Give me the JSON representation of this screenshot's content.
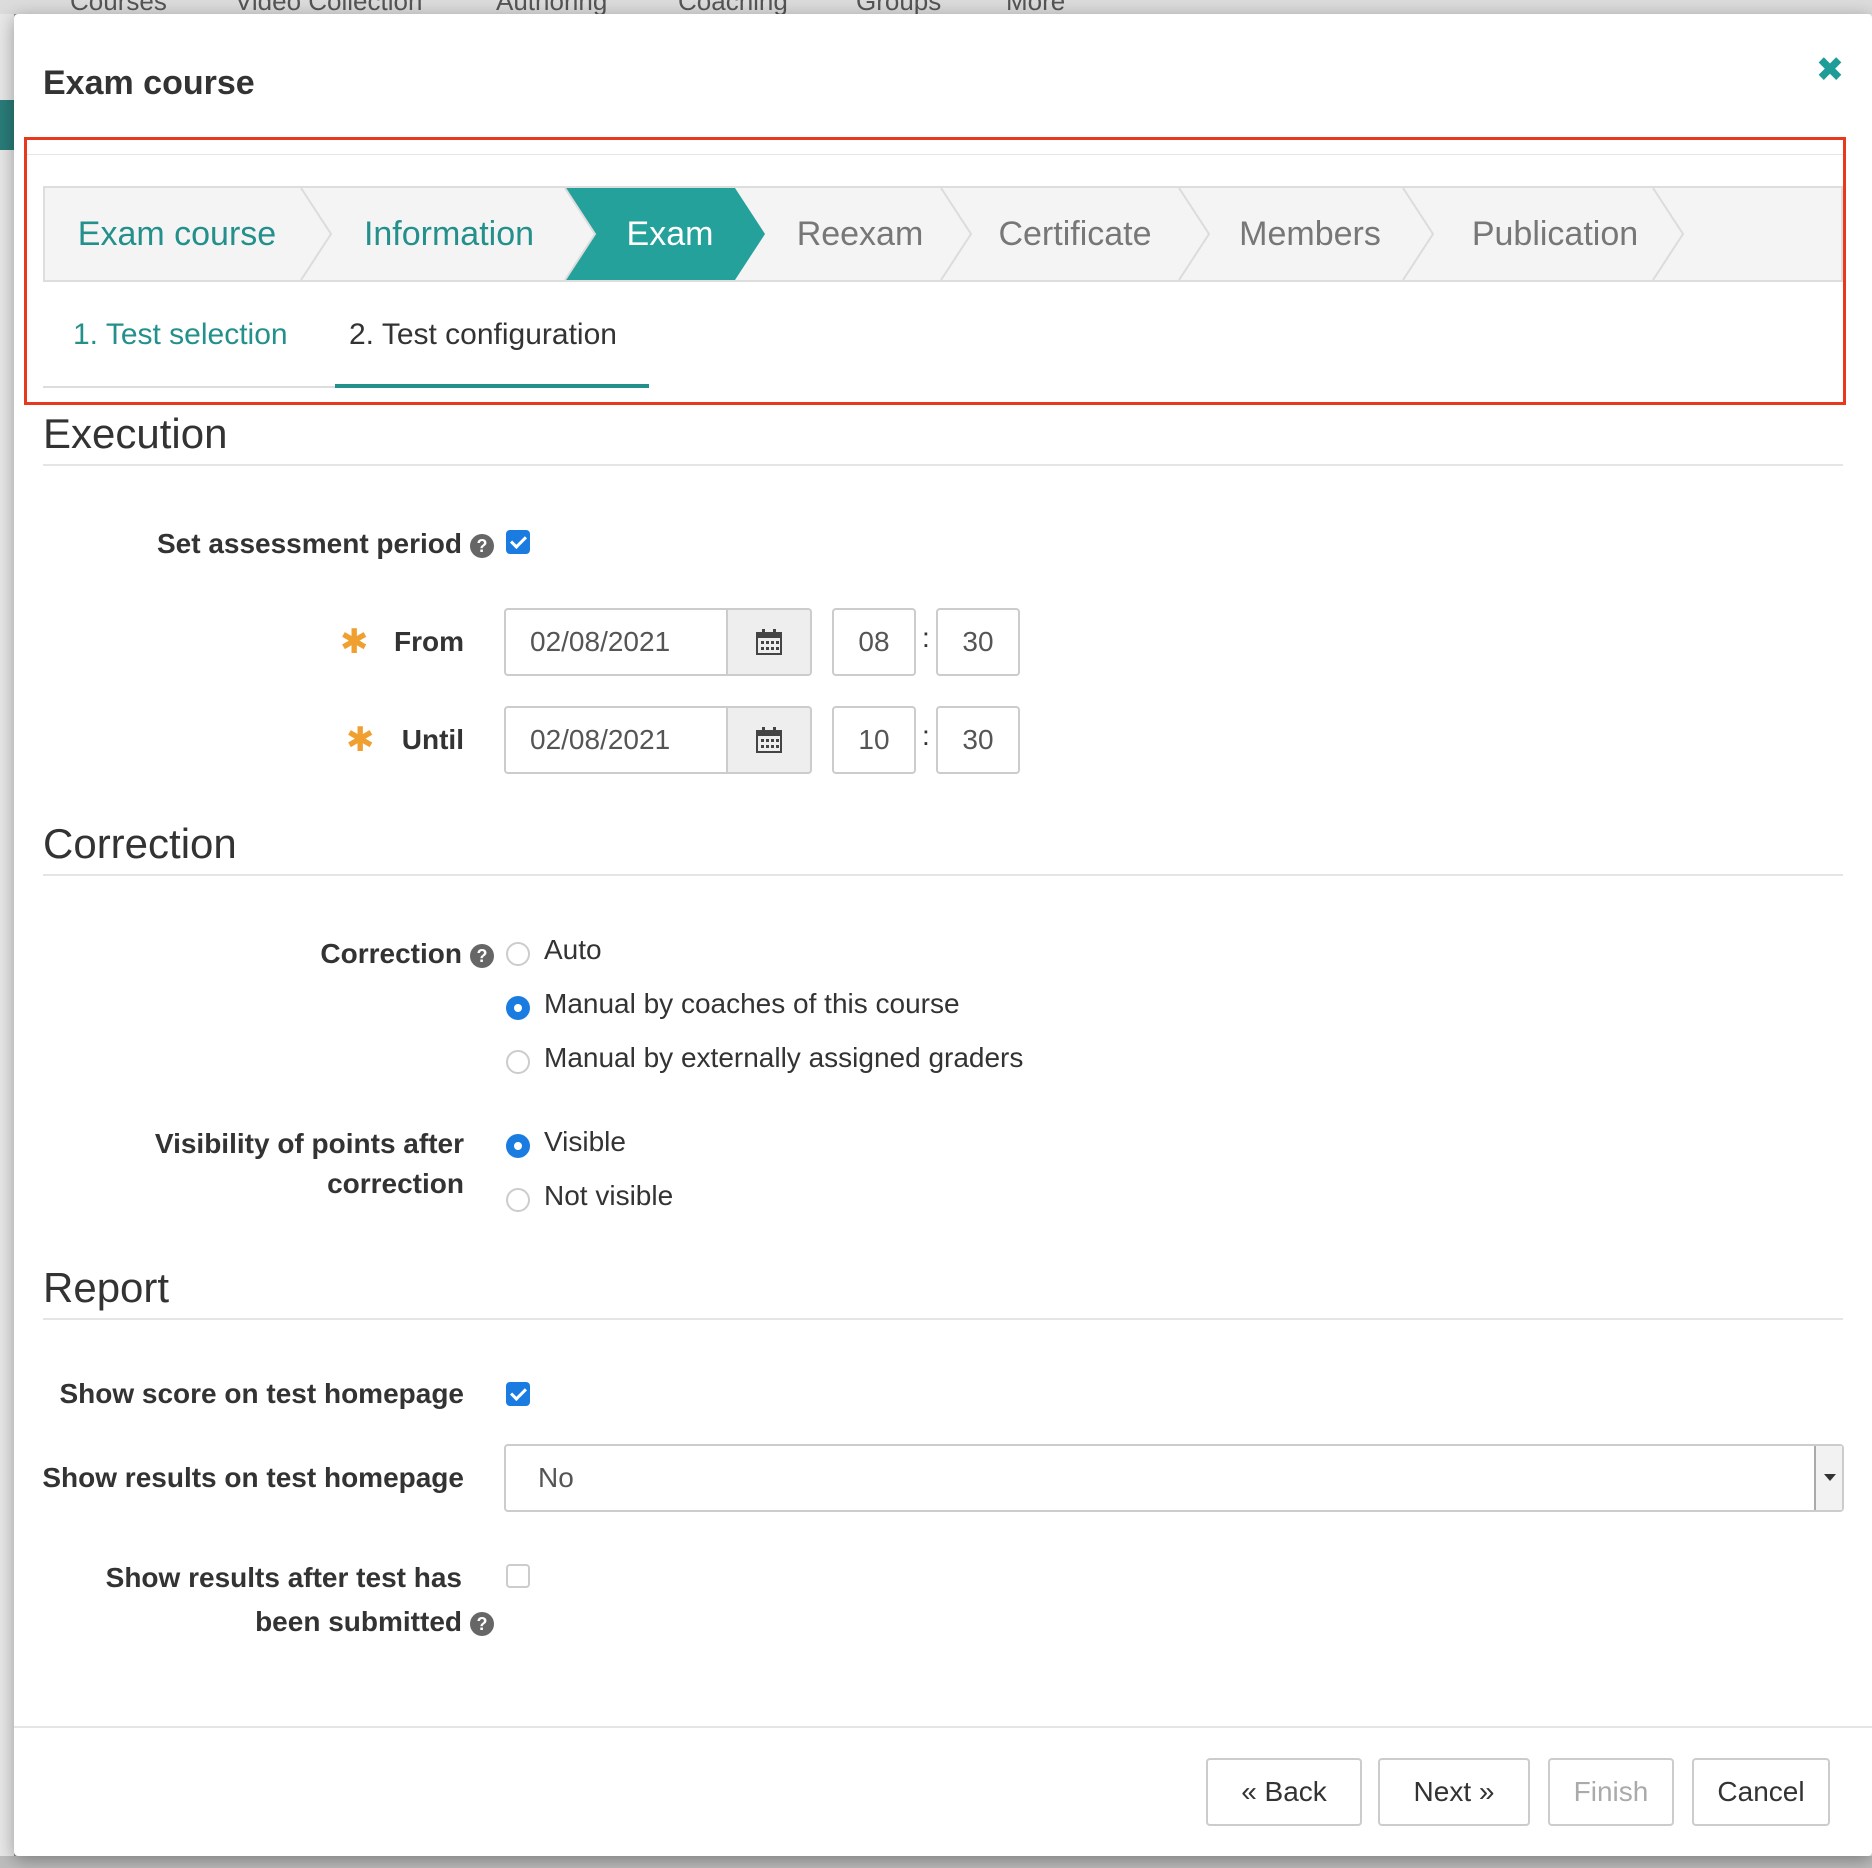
{
  "background_nav": [
    "Courses",
    "Video Collection",
    "Authoring",
    "Coaching",
    "Groups",
    "More"
  ],
  "modal": {
    "title": "Exam course",
    "close_icon": "close-icon"
  },
  "wizard": {
    "steps": [
      {
        "label": "Exam course",
        "state": "done"
      },
      {
        "label": "Information",
        "state": "done"
      },
      {
        "label": "Exam",
        "state": "active"
      },
      {
        "label": "Reexam",
        "state": "pending"
      },
      {
        "label": "Certificate",
        "state": "pending"
      },
      {
        "label": "Members",
        "state": "pending"
      },
      {
        "label": "Publication",
        "state": "pending"
      }
    ],
    "accent_color": "#25a19c"
  },
  "subtabs": [
    {
      "label": "1. Test selection"
    },
    {
      "label": "2. Test configuration"
    }
  ],
  "execution": {
    "title": "Execution",
    "assessment_period_label": "Set assessment period",
    "assessment_period_checked": true,
    "from_label": "From",
    "from_date": "02/08/2021",
    "from_hour": "08",
    "from_minute": "30",
    "until_label": "Until",
    "until_date": "02/08/2021",
    "until_hour": "10",
    "until_minute": "30",
    "time_separator": ":"
  },
  "correction": {
    "title": "Correction",
    "correction_label": "Correction",
    "options": [
      {
        "label": "Auto",
        "selected": false
      },
      {
        "label": "Manual by coaches of this course",
        "selected": true
      },
      {
        "label": "Manual by externally assigned graders",
        "selected": false
      }
    ],
    "visibility_label_1": "Visibility of points after",
    "visibility_label_2": "correction",
    "visibility_options": [
      {
        "label": "Visible",
        "selected": true
      },
      {
        "label": "Not visible",
        "selected": false
      }
    ]
  },
  "report": {
    "title": "Report",
    "show_score_label": "Show score on test homepage",
    "show_score_checked": true,
    "show_results_label": "Show results on test homepage",
    "show_results_value": "No",
    "after_submit_label_1": "Show results after test has",
    "after_submit_label_2": "been submitted",
    "after_submit_checked": false
  },
  "footer": {
    "back": "Back",
    "next": "Next",
    "finish": "Finish",
    "cancel": "Cancel"
  },
  "help_glyph": "?",
  "required_glyph": "✱",
  "back_glyph": "«",
  "next_glyph": "»",
  "close_glyph": "✖"
}
